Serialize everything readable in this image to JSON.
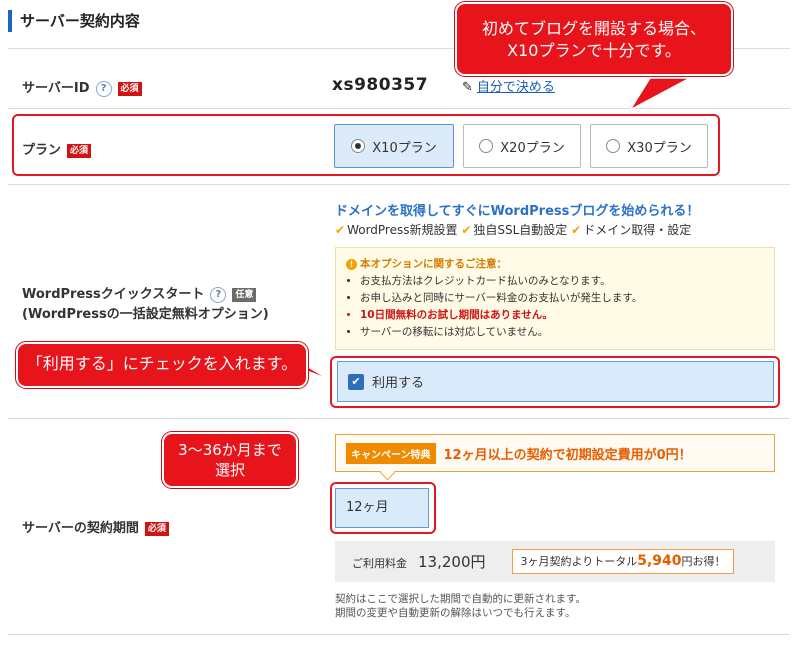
{
  "section_title": "サーバー契約内容",
  "server_id": {
    "label": "サーバーID",
    "required_badge": "必須",
    "help": "?",
    "value": "xs980357",
    "edit_link": "自分で決める"
  },
  "plan": {
    "label": "プラン",
    "required_badge": "必須",
    "options": [
      "X10プラン",
      "X20プラン",
      "X30プラン"
    ],
    "selected": "X10プラン"
  },
  "wp_quick_start": {
    "label": "WordPressクイックスタート",
    "optional_badge": "任意",
    "help": "?",
    "sublabel": "(WordPressの一括設定無料オプション)",
    "headline": "ドメインを取得してすぐにWordPressブログを始められる！",
    "features": [
      "WordPress新規設置",
      "独自SSL自動設定",
      "ドメイン取得・設定"
    ],
    "notice_title": "本オプションに関するご注意：",
    "notice_items": [
      "お支払方法はクレジットカード払いのみとなります。",
      "お申し込みと同時にサーバー料金のお支払いが発生します。",
      "10日間無料のお試し期間はありません。",
      "サーバーの移転には対応していません。"
    ],
    "use_checkbox_label": "利用する",
    "use_checked": true
  },
  "contract_period": {
    "label": "サーバーの契約期間",
    "required_badge": "必須",
    "campaign_badge": "キャンペーン特典",
    "campaign_text": "12ヶ月以上の契約で初期設定費用が0円！",
    "selected_value": "12ヶ月",
    "fee_label": "ご利用料金",
    "fee_value": "13,200円",
    "savings_prefix": "3ヶ月契約よりトータル",
    "savings_amount": "5,940",
    "savings_suffix": "円お得！",
    "renew_note_1": "契約はここで選択した期間で自動的に更新されます。",
    "renew_note_2": "期間の変更や自動更新の解除はいつでも行えます。"
  },
  "callouts": {
    "plan_note_line1": "初めてブログを開設する場合、",
    "plan_note_line2": "X10プランで十分です。",
    "use_note": "「利用する」にチェックを入れます。",
    "period_note_line1": "3〜36か月まで",
    "period_note_line2": "選択"
  },
  "colors": {
    "accent_blue": "#1a66c2",
    "required_red": "#d01414",
    "callout_red": "#e8141c",
    "campaign_orange": "#f08a00",
    "selected_bg": "#dcebfa"
  }
}
